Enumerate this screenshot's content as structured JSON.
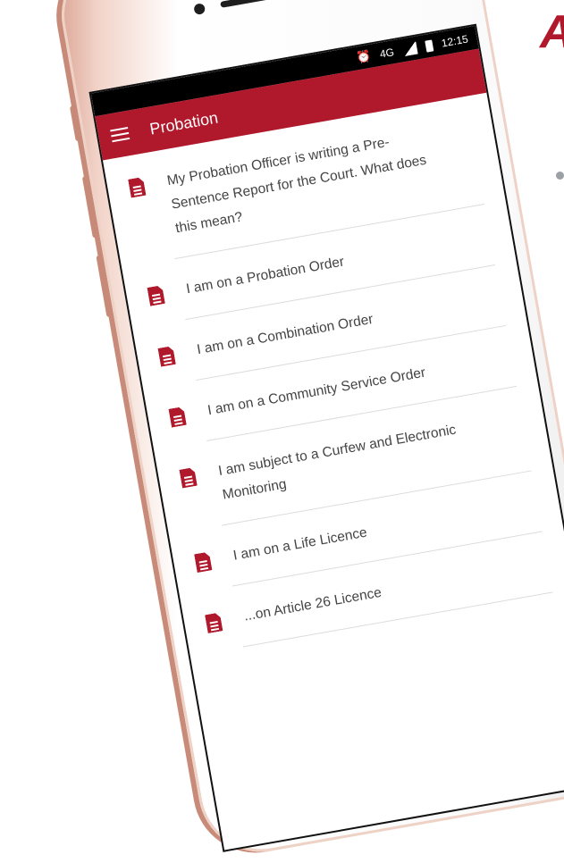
{
  "slide": {
    "heading_fragment": "A"
  },
  "status_bar": {
    "alarm_icon": "alarm-clock-icon",
    "network": "4G",
    "time": "12:15"
  },
  "app_bar": {
    "menu_icon": "hamburger-menu-icon",
    "title": "Probation"
  },
  "list": {
    "items": [
      {
        "label": "My Probation Officer is writing a Pre-Sentence Report for the Court. What does this mean?",
        "icon": "document-icon"
      },
      {
        "label": "I am on a Probation Order",
        "icon": "document-icon"
      },
      {
        "label": "I am on a Combination Order",
        "icon": "document-icon"
      },
      {
        "label": "I am on a Community Service Order",
        "icon": "document-icon"
      },
      {
        "label": "I am subject to a Curfew and Electronic Monitoring",
        "icon": "document-icon"
      },
      {
        "label": "I am on a Life Licence",
        "icon": "document-icon"
      },
      {
        "label": "...on Article 26 Licence",
        "icon": "document-icon"
      }
    ]
  },
  "colors": {
    "brand": "#b0182c",
    "status_bar_bg": "#000000",
    "phone_frame": "#f2d3c8"
  }
}
